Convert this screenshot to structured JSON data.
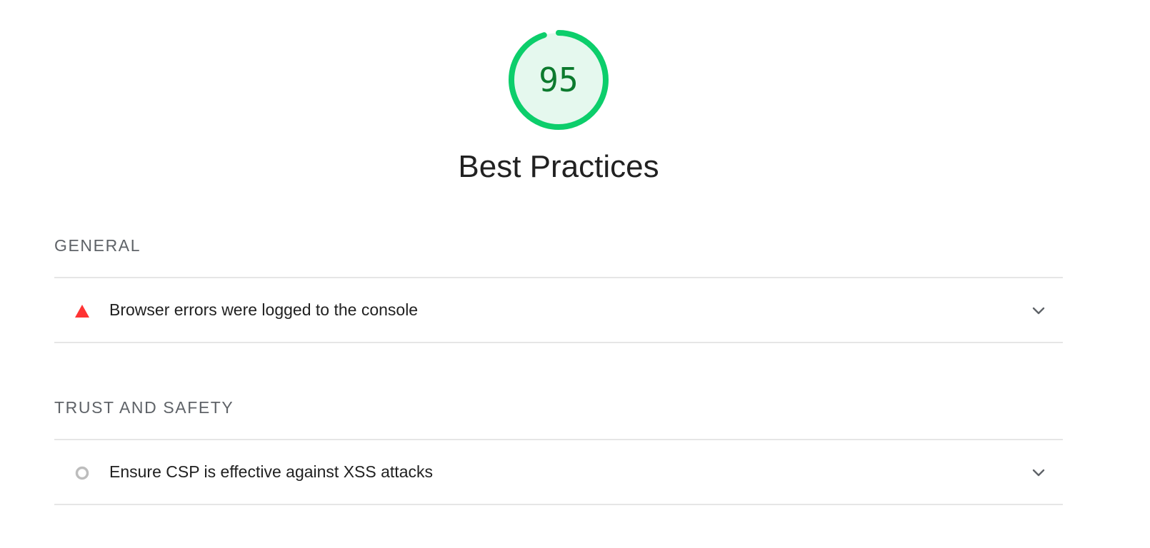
{
  "score": {
    "value": "95",
    "fraction": 0.95,
    "ring_color": "#0cce6b",
    "fill_color": "#e5f8ee",
    "text_color": "#0c7a2e"
  },
  "category": {
    "title": "Best Practices"
  },
  "groups": [
    {
      "heading": "GENERAL",
      "audits": [
        {
          "title": "Browser errors were logged to the console",
          "status_icon": "fail-triangle-icon",
          "status_color": "#ff3333"
        }
      ]
    },
    {
      "heading": "TRUST AND SAFETY",
      "audits": [
        {
          "title": "Ensure CSP is effective against XSS attacks",
          "status_icon": "informative-circle-icon",
          "status_color": "#bdbdbd"
        }
      ]
    }
  ]
}
